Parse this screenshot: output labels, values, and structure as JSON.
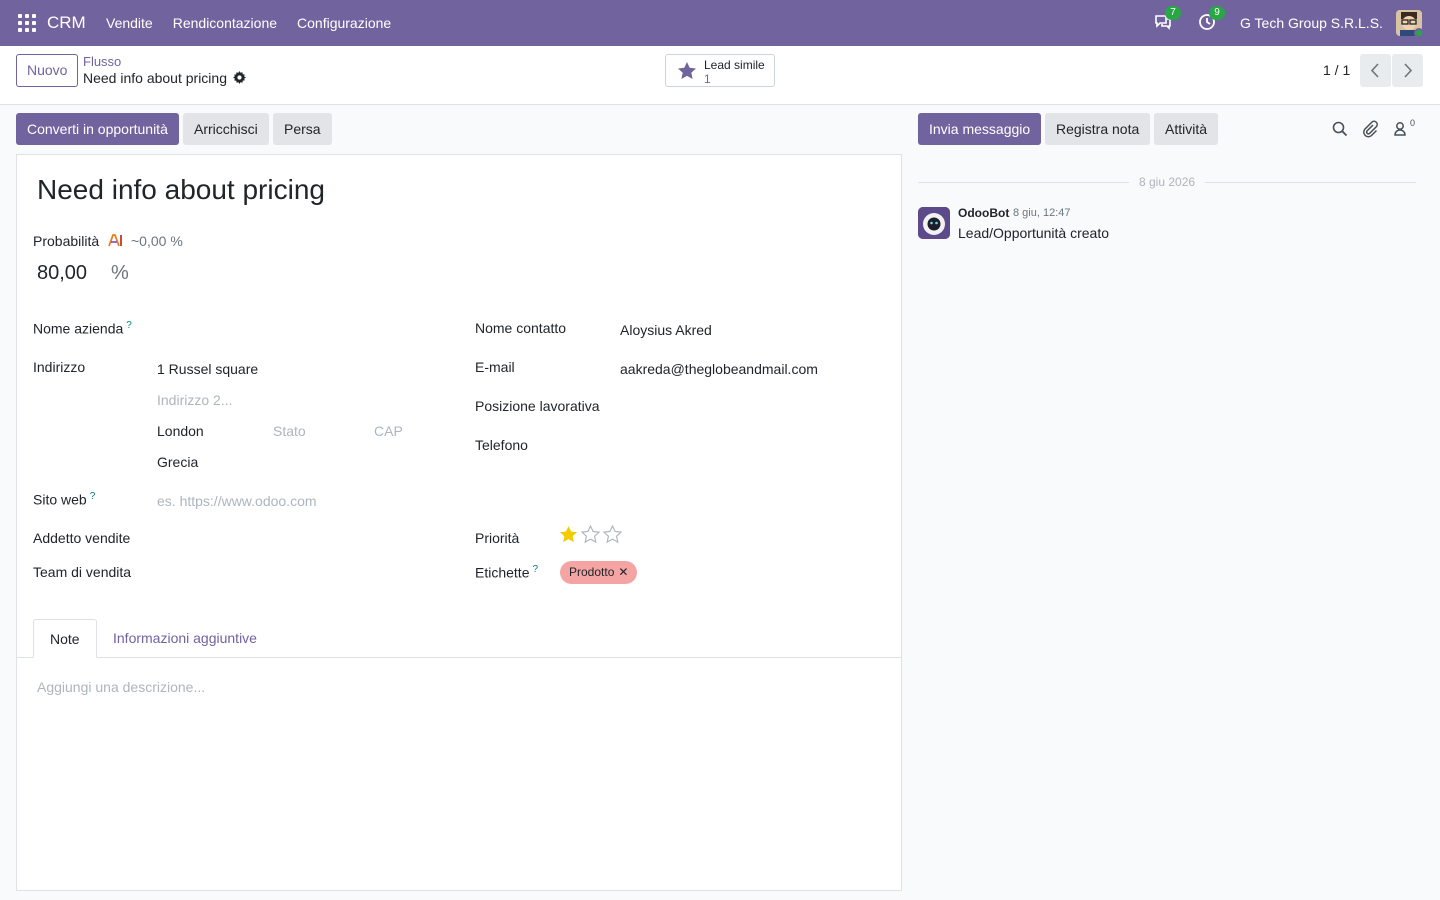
{
  "navbar": {
    "brand": "CRM",
    "menu": [
      "Vendite",
      "Rendicontazione",
      "Configurazione"
    ],
    "messages_count": "7",
    "activities_count": "9",
    "company": "G Tech Group S.R.L.S."
  },
  "control": {
    "new_label": "Nuovo",
    "breadcrumb_parent": "Flusso",
    "breadcrumb_current": "Need info about pricing",
    "smart_button": {
      "label": "Lead simile",
      "value": "1"
    },
    "pager": "1 / 1"
  },
  "statusbar": {
    "convert": "Converti in opportunità",
    "enrich": "Arricchisci",
    "lost": "Persa"
  },
  "form": {
    "title": "Need info about pricing",
    "probability_label": "Probabilità",
    "probability_ai": "~0,00 %",
    "probability_value": "80,00",
    "probability_unit": "%",
    "company_label": "Nome azienda",
    "address_label": "Indirizzo",
    "street": "1 Russel square",
    "street2_placeholder": "Indirizzo 2...",
    "city": "London",
    "state_placeholder": "Stato",
    "zip_placeholder": "CAP",
    "country": "Grecia",
    "website_label": "Sito web",
    "website_placeholder": "es. https://www.odoo.com",
    "salesperson_label": "Addetto vendite",
    "team_label": "Team di vendita",
    "contact_label": "Nome contatto",
    "contact_value": "Aloysius Akred",
    "email_label": "E-mail",
    "email_value": "aakreda@theglobeandmail.com",
    "job_label": "Posizione lavorativa",
    "phone_label": "Telefono",
    "priority_label": "Priorità",
    "priority_stars": 1,
    "priority_max": 3,
    "tags_label": "Etichette",
    "tag": "Prodotto",
    "help_mark": "?"
  },
  "tabs": {
    "notes": "Note",
    "extra": "Informazioni aggiuntive",
    "description_placeholder": "Aggiungi una descrizione..."
  },
  "chatter": {
    "send_message": "Invia messaggio",
    "log_note": "Registra nota",
    "activities": "Attività",
    "followers_count": "0",
    "date_separator": "8 giu 2026",
    "message": {
      "author": "OdooBot",
      "date": "8 giu, 12:47",
      "body": "Lead/Opportunità creato"
    }
  },
  "colors": {
    "brand": "#71639e",
    "badge": "#28a745",
    "tag": "#f5a4a4",
    "star": "#f3cc00"
  }
}
